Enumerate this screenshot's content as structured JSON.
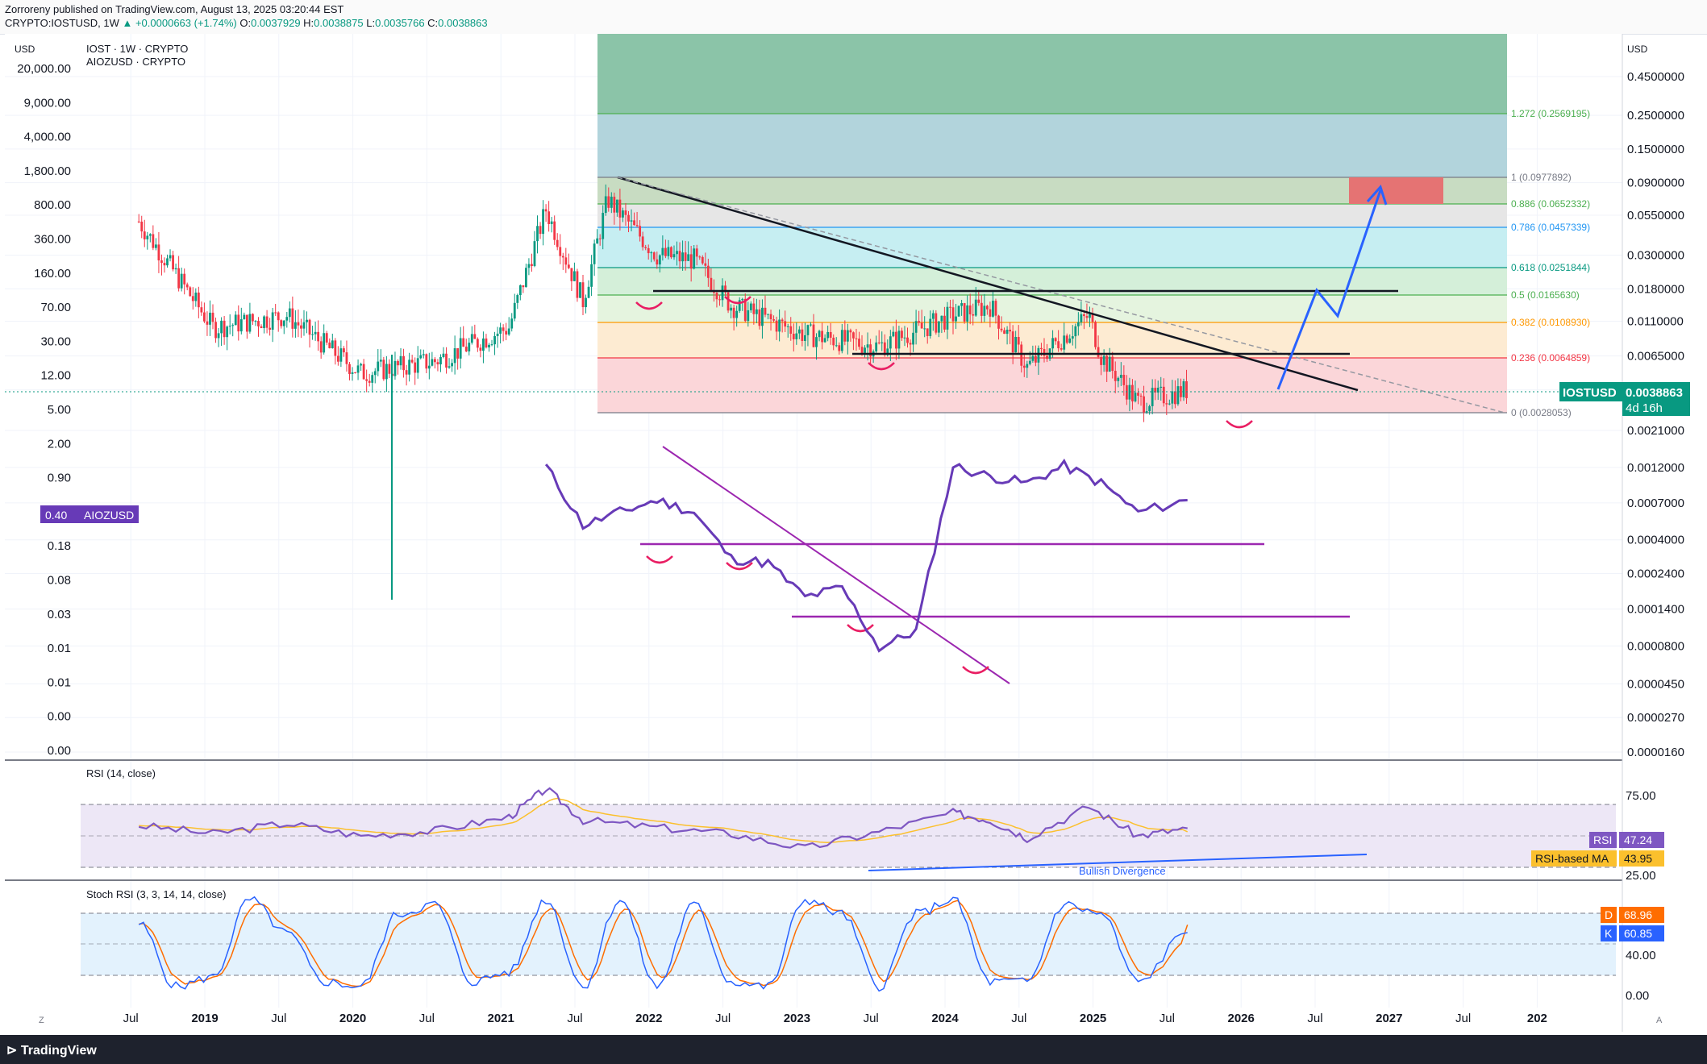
{
  "header": {
    "published": "Zorroreny published on TradingView.com, August 13, 2025 03:20:44 EST",
    "symbol": "CRYPTO:IOSTUSD",
    "interval": "1W",
    "change": "+0.0000663 (+1.74%)",
    "ohlc": {
      "O": "0.0037929",
      "H": "0.0038875",
      "L": "0.0035766",
      "C": "0.0038863"
    }
  },
  "main_pane": {
    "legend_title": "IOST · 1W · CRYPTO",
    "legend_sub": "AIOZUSD · CRYPTO",
    "left_unit": "USD",
    "right_unit": "USD",
    "left_axis_labels": [
      "20,000.00",
      "9,000.00",
      "4,000.00",
      "1,800.00",
      "800.00",
      "360.00",
      "160.00",
      "70.00",
      "30.00",
      "12.00",
      "5.00",
      "2.00",
      "0.90",
      "0.40",
      "0.18",
      "0.08",
      "0.03",
      "0.01",
      "0.01",
      "0.00",
      "0.00"
    ],
    "right_axis_labels": [
      "0.4500000",
      "0.2500000",
      "0.1500000",
      "0.0900000",
      "0.0550000",
      "0.0300000",
      "0.0180000",
      "0.0110000",
      "0.0065000",
      "0.0038863",
      "0.0021000",
      "0.0012000",
      "0.0007000",
      "0.0004000",
      "0.0002400",
      "0.0001400",
      "0.0000800",
      "0.0000450",
      "0.0000270",
      "0.0000160"
    ],
    "aioz_badge": {
      "value": "0.40",
      "name": "AIOZUSD"
    },
    "price_badge": {
      "symbol": "IOSTUSD",
      "price": "0.0038863",
      "countdown": "4d 16h"
    },
    "fib_levels": [
      {
        "label": "1.272 (0.2569195)",
        "color": "#4caf50"
      },
      {
        "label": "1 (0.0977892)",
        "color": "#787b86"
      },
      {
        "label": "0.886 (0.0652332)",
        "color": "#4caf50"
      },
      {
        "label": "0.786 (0.0457339)",
        "color": "#2196f3"
      },
      {
        "label": "0.618 (0.0251844)",
        "color": "#089981"
      },
      {
        "label": "0.5 (0.0165630)",
        "color": "#4caf50"
      },
      {
        "label": "0.382 (0.0108930)",
        "color": "#ff9800"
      },
      {
        "label": "0.236 (0.0064859)",
        "color": "#f23645"
      },
      {
        "label": "0 (0.0028053)",
        "color": "#787b86"
      }
    ]
  },
  "rsi_pane": {
    "title": "RSI (14, close)",
    "axis_labels": [
      "75.00",
      "25.00"
    ],
    "rsi_badge": {
      "name": "RSI",
      "value": "47.24"
    },
    "ma_badge": {
      "name": "RSI-based MA",
      "value": "43.95"
    },
    "annotation": "Bullish Divergence"
  },
  "stoch_pane": {
    "title": "Stoch RSI (3, 3, 14, 14, close)",
    "axis_labels": [
      "40.00",
      "0.00"
    ],
    "d_badge": {
      "name": "D",
      "value": "68.96"
    },
    "k_badge": {
      "name": "K",
      "value": "60.85"
    }
  },
  "time_axis": [
    "Jul",
    "2019",
    "Jul",
    "2020",
    "Jul",
    "2021",
    "Jul",
    "2022",
    "Jul",
    "2023",
    "Jul",
    "2024",
    "Jul",
    "2025",
    "Jul",
    "2026",
    "Jul",
    "2027",
    "Jul",
    "202"
  ],
  "footer": {
    "brand": "TradingView"
  },
  "colors": {
    "up": "#089981",
    "down": "#f23645",
    "aioz_line": "#673ab7",
    "projection": "#2962ff",
    "rsi": "#7e57c2",
    "rsi_ma": "#fbc02d",
    "stoch_k": "#2962ff",
    "stoch_d": "#ff6d00",
    "target_box": "#e57373"
  },
  "chart_data": [
    {
      "type": "line",
      "series": [
        {
          "name": "IOSTUSD",
          "x": [
            "2018-07",
            "2019-01",
            "2019-07",
            "2020-01",
            "2020-07",
            "2021-01",
            "2021-04",
            "2021-07",
            "2021-09",
            "2022-01",
            "2022-04",
            "2022-07",
            "2023-01",
            "2023-07",
            "2024-01",
            "2024-04",
            "2024-07",
            "2024-12",
            "2025-01",
            "2025-04",
            "2025-08"
          ],
          "values": [
            0.05,
            0.01,
            0.012,
            0.005,
            0.006,
            0.01,
            0.06,
            0.015,
            0.07,
            0.03,
            0.028,
            0.014,
            0.009,
            0.0075,
            0.012,
            0.014,
            0.0055,
            0.012,
            0.0065,
            0.0032,
            0.0038863
          ]
        }
      ],
      "ylim": [
        1.6e-05,
        0.45
      ]
    },
    {
      "type": "line",
      "series": [
        {
          "name": "AIOZUSD",
          "x": [
            "2021-04",
            "2021-07",
            "2021-10",
            "2022-01",
            "2022-04",
            "2022-07",
            "2022-10",
            "2023-01",
            "2023-04",
            "2023-07",
            "2023-10",
            "2024-01",
            "2024-04",
            "2024-07",
            "2024-10",
            "2025-01",
            "2025-04",
            "2025-08"
          ],
          "values": [
            0.9,
            0.22,
            0.3,
            0.4,
            0.3,
            0.1,
            0.09,
            0.04,
            0.05,
            0.012,
            0.018,
            0.9,
            0.7,
            0.6,
            0.9,
            0.6,
            0.3,
            0.4
          ]
        }
      ]
    },
    {
      "type": "line",
      "series": [
        {
          "name": "RSI",
          "x": [
            "2018-07",
            "2019-01",
            "2019-07",
            "2020-01",
            "2020-07",
            "2021-01",
            "2021-04",
            "2021-07",
            "2022-01",
            "2022-07",
            "2023-01",
            "2023-07",
            "2024-01",
            "2024-04",
            "2024-07",
            "2024-12",
            "2025-04",
            "2025-08"
          ],
          "values": [
            50,
            42,
            52,
            40,
            45,
            58,
            85,
            55,
            48,
            42,
            28,
            44,
            62,
            55,
            38,
            68,
            40,
            47.24
          ]
        }
      ],
      "ylim": [
        0,
        100
      ]
    },
    {
      "type": "line",
      "series": [
        {
          "name": "K",
          "x": [
            "2018-07",
            "2018-10",
            "2019-01",
            "2019-04",
            "2019-07",
            "2019-10",
            "2020-01",
            "2020-04",
            "2020-07",
            "2020-10",
            "2021-01",
            "2021-04",
            "2021-07",
            "2021-10",
            "2022-01",
            "2022-04",
            "2022-07",
            "2022-10",
            "2023-01",
            "2023-04",
            "2023-07",
            "2023-10",
            "2024-01",
            "2024-04",
            "2024-07",
            "2024-10",
            "2025-01",
            "2025-04",
            "2025-08"
          ],
          "values": [
            70,
            5,
            15,
            95,
            60,
            10,
            5,
            80,
            90,
            10,
            20,
            95,
            5,
            95,
            5,
            90,
            10,
            5,
            95,
            80,
            5,
            80,
            95,
            10,
            10,
            90,
            80,
            10,
            60.85
          ]
        }
      ],
      "ylim": [
        0,
        100
      ]
    }
  ]
}
